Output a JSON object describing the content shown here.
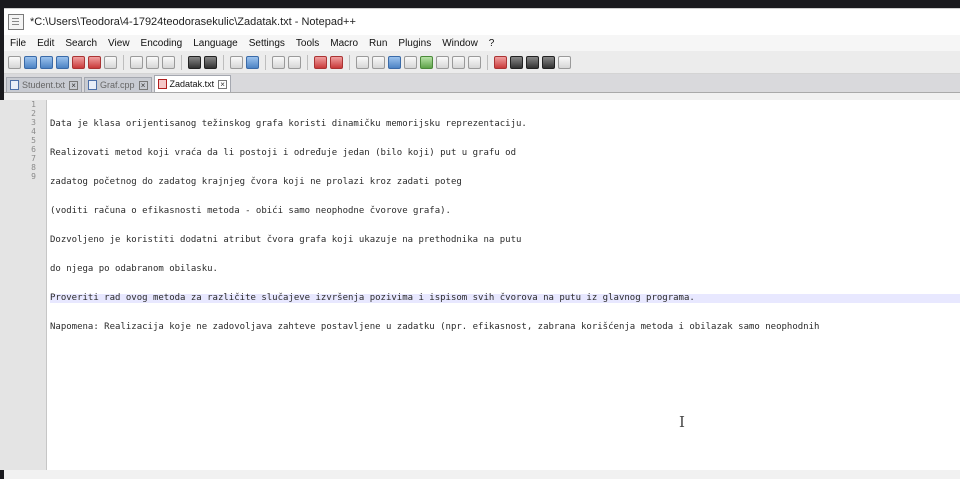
{
  "window": {
    "title": "*C:\\Users\\Teodora\\4-17924teodorasekulic\\Zadatak.txt - Notepad++"
  },
  "menu": {
    "items": [
      "File",
      "Edit",
      "Search",
      "View",
      "Encoding",
      "Language",
      "Settings",
      "Tools",
      "Macro",
      "Run",
      "Plugins",
      "Window",
      "?"
    ]
  },
  "tabs": [
    {
      "label": "Student.txt",
      "active": false
    },
    {
      "label": "Graf.cpp",
      "active": false
    },
    {
      "label": "Zadatak.txt",
      "active": true
    }
  ],
  "editor": {
    "line_numbers": [
      "1",
      "2",
      "3",
      "4",
      "5",
      "6",
      "7",
      "8",
      "9"
    ],
    "lines": [
      "Data je klasa orijentisanog težinskog grafa koristi dinamičku memorijsku reprezentaciju.",
      "Realizovati metod koji vraća da li postoji i određuje jedan (bilo koji) put u grafu od",
      "zadatog početnog do zadatog krajnjeg čvora koji ne prolazi kroz zadati poteg",
      "(voditi računa o efikasnosti metoda - obići samo neophodne čvorove grafa).",
      "Dozvoljeno je koristiti dodatni atribut čvora grafa koji ukazuje na prethodnika na putu",
      "do njega po odabranom obilasku.",
      "Proveriti rad ovog metoda za različite slučajeve izvršenja pozivima i ispisom svih čvorova na putu iz glavnog programa.",
      "Napomena: Realizacija koje ne zadovoljava zahteve postavljene u zadatku (npr. efikasnost, zabrana korišćenja metoda i obilazak samo neophodnih",
      ""
    ],
    "current_line": 7
  },
  "colors": {
    "gutter_bg": "#e4e4e4",
    "current_line_bg": "#e8e8ff",
    "tab_active_bg": "#ffffff"
  }
}
